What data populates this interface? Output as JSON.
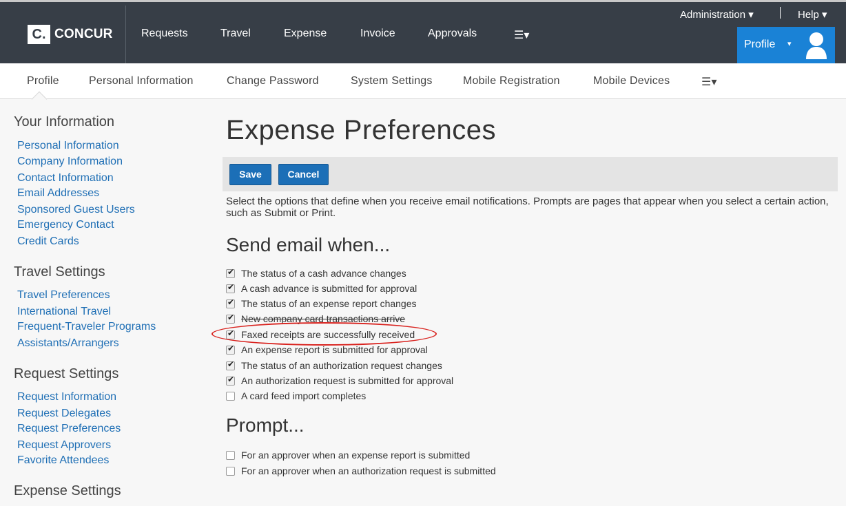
{
  "brand": {
    "logo_mark": "C.",
    "logo_text": "CONCUR"
  },
  "top_nav": {
    "items": [
      "Requests",
      "Travel",
      "Expense",
      "Invoice",
      "Approvals"
    ],
    "more": "☰▾",
    "admin": "Administration ▾",
    "help": "Help ▾",
    "profile": "Profile",
    "profile_caret": "▾"
  },
  "sub_nav": {
    "items": [
      "Profile",
      "Personal Information",
      "Change Password",
      "System Settings",
      "Mobile Registration",
      "Mobile Devices"
    ],
    "more": "☰▾"
  },
  "sidebar": {
    "your_information": {
      "heading": "Your Information",
      "links": [
        "Personal Information",
        "Company Information",
        "Contact Information",
        "Email Addresses",
        "Sponsored Guest Users",
        "Emergency Contact",
        "Credit Cards"
      ]
    },
    "travel_settings": {
      "heading": "Travel Settings",
      "links": [
        "Travel Preferences",
        "International Travel",
        "Frequent-Traveler Programs",
        "Assistants/Arrangers"
      ]
    },
    "request_settings": {
      "heading": "Request Settings",
      "links": [
        "Request Information",
        "Request Delegates",
        "Request Preferences",
        "Request Approvers",
        "Favorite Attendees"
      ]
    },
    "expense_settings": {
      "heading": "Expense Settings"
    }
  },
  "main": {
    "title": "Expense Preferences",
    "save_label": "Save",
    "cancel_label": "Cancel",
    "intro": "Select the options that define when you receive email notifications. Prompts are pages that appear when you select a certain action, such as Submit or Print.",
    "send_email_heading": "Send email when...",
    "send_email_options": [
      {
        "label": "The status of a cash advance changes",
        "checked": true
      },
      {
        "label": "A cash advance is submitted for approval",
        "checked": true
      },
      {
        "label": "The status of an expense report changes",
        "checked": true
      },
      {
        "label": "New company card transactions arrive",
        "checked": true
      },
      {
        "label": "Faxed receipts are successfully received",
        "checked": true
      },
      {
        "label": "An expense report is submitted for approval",
        "checked": true
      },
      {
        "label": "The status of an authorization request changes",
        "checked": true
      },
      {
        "label": "An authorization request is submitted for approval",
        "checked": true
      },
      {
        "label": "A card feed import completes",
        "checked": false
      }
    ],
    "prompt_heading": "Prompt...",
    "prompt_options": [
      {
        "label": "For an approver when an expense report is submitted",
        "checked": false
      },
      {
        "label": "For an approver when an authorization request is submitted",
        "checked": false
      }
    ]
  },
  "colors": {
    "header_bg": "#373e47",
    "profile_bg": "#1a82d6",
    "link": "#1f6fb5",
    "button": "#1c6fb7",
    "annotation": "#d9231f"
  }
}
